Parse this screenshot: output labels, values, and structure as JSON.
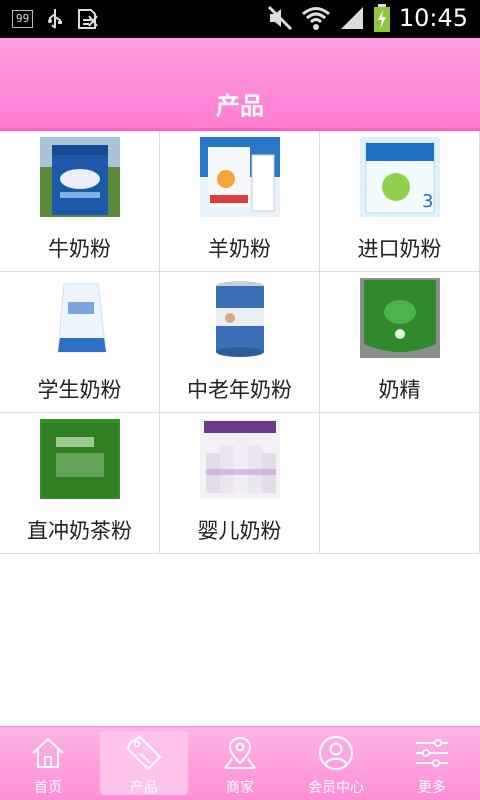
{
  "status_bar": {
    "notification_badge": "99",
    "time": "10:45",
    "icons": [
      "notification-count-icon",
      "usb-icon",
      "sim-card-icon",
      "mute-icon",
      "wifi-icon",
      "signal-icon",
      "battery-charging-icon"
    ]
  },
  "header": {
    "title": "产品"
  },
  "products": [
    {
      "label": "牛奶粉",
      "image": "milk-powder-bag-image"
    },
    {
      "label": "羊奶粉",
      "image": "goat-milk-powder-image"
    },
    {
      "label": "进口奶粉",
      "image": "imported-formula-image"
    },
    {
      "label": "学生奶粉",
      "image": "student-milk-powder-image"
    },
    {
      "label": "中老年奶粉",
      "image": "senior-milk-powder-can-image"
    },
    {
      "label": "奶精",
      "image": "creamer-bag-image"
    },
    {
      "label": "直冲奶茶粉",
      "image": "milk-tea-powder-bag-image"
    },
    {
      "label": "婴儿奶粉",
      "image": "infant-formula-cans-image"
    }
  ],
  "nav": {
    "items": [
      {
        "label": "首页",
        "icon": "home-icon"
      },
      {
        "label": "产品",
        "icon": "sale-tag-icon",
        "active": true
      },
      {
        "label": "商家",
        "icon": "map-location-icon"
      },
      {
        "label": "会员中心",
        "icon": "user-profile-icon"
      },
      {
        "label": "更多",
        "icon": "settings-sliders-icon"
      }
    ]
  },
  "colors": {
    "header_pink": "#ff7dd2",
    "nav_pink": "#ff9ed8",
    "divider": "#dcdcdc"
  }
}
